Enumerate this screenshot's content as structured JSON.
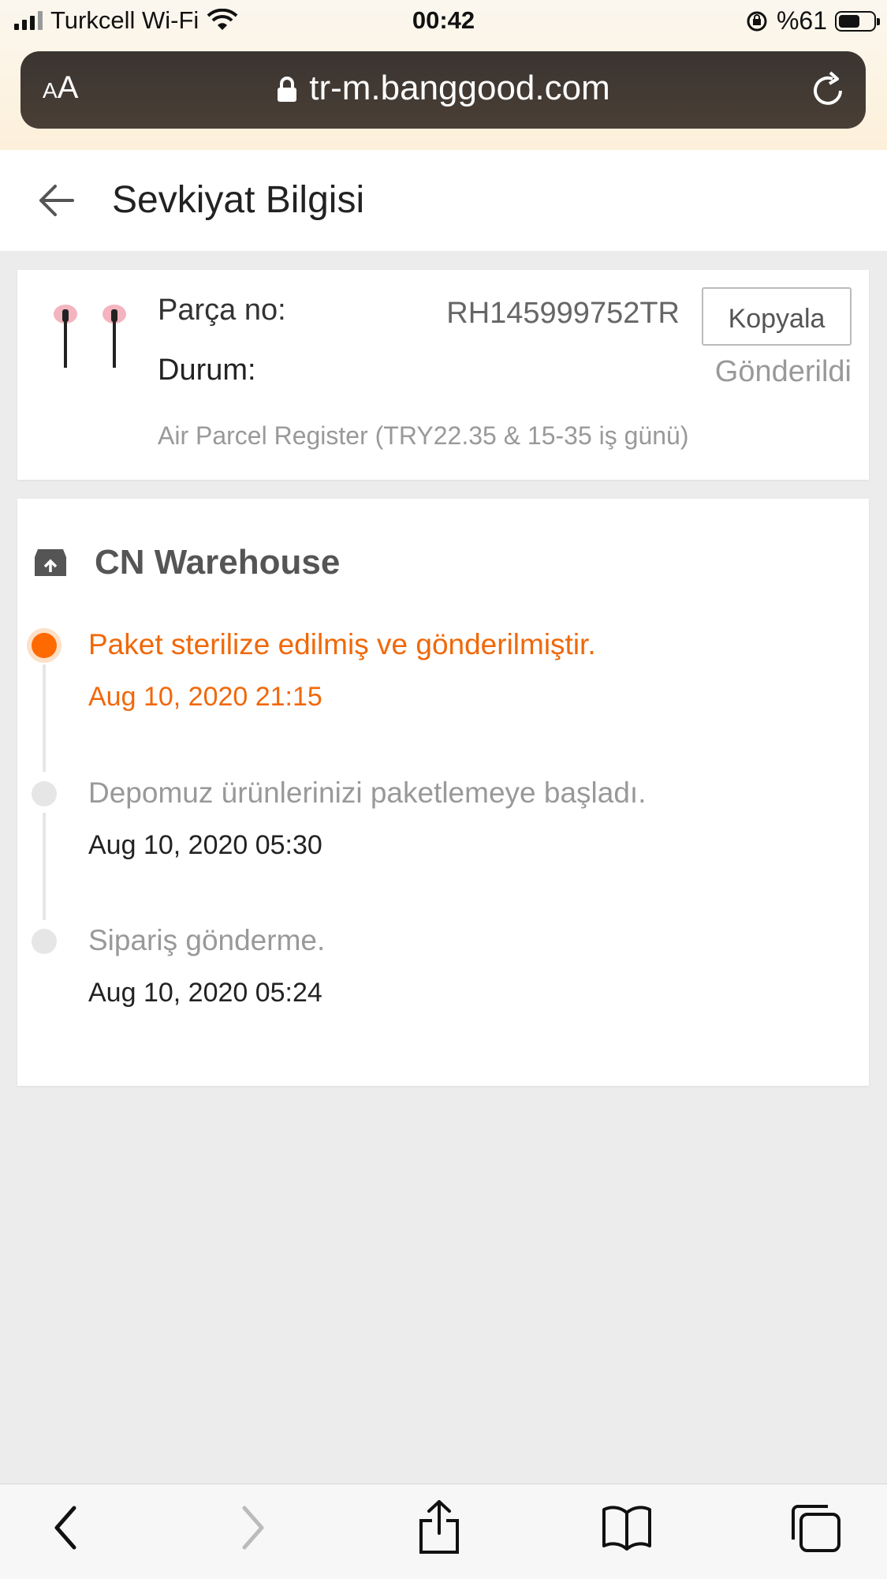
{
  "status_bar": {
    "carrier": "Turkcell Wi-Fi",
    "time": "00:42",
    "battery": "%61",
    "battery_level": 0.61
  },
  "browser": {
    "text_size_label": "AA",
    "url": "tr-m.banggood.com"
  },
  "header": {
    "title": "Sevkiyat Bilgisi"
  },
  "parcel": {
    "parcel_label": "Parça no:",
    "parcel_number": "RH145999752TR",
    "copy_label": "Kopyala",
    "status_label": "Durum:",
    "status_value": "Gönderildi",
    "shipping_method": "Air Parcel Register (TRY22.35 & 15-35 iş günü)"
  },
  "tracking": {
    "warehouse": "CN Warehouse",
    "events": [
      {
        "text": "Paket sterilize edilmiş ve gönderilmiştir.",
        "time": "Aug 10, 2020 21:15",
        "active": true
      },
      {
        "text": "Depomuz ürünlerinizi paketlemeye başladı.",
        "time": "Aug 10, 2020 05:30",
        "active": false
      },
      {
        "text": "Sipariş gönderme.",
        "time": "Aug 10, 2020 05:24",
        "active": false
      }
    ]
  },
  "colors": {
    "accent": "#f0680a",
    "muted": "#999999"
  }
}
